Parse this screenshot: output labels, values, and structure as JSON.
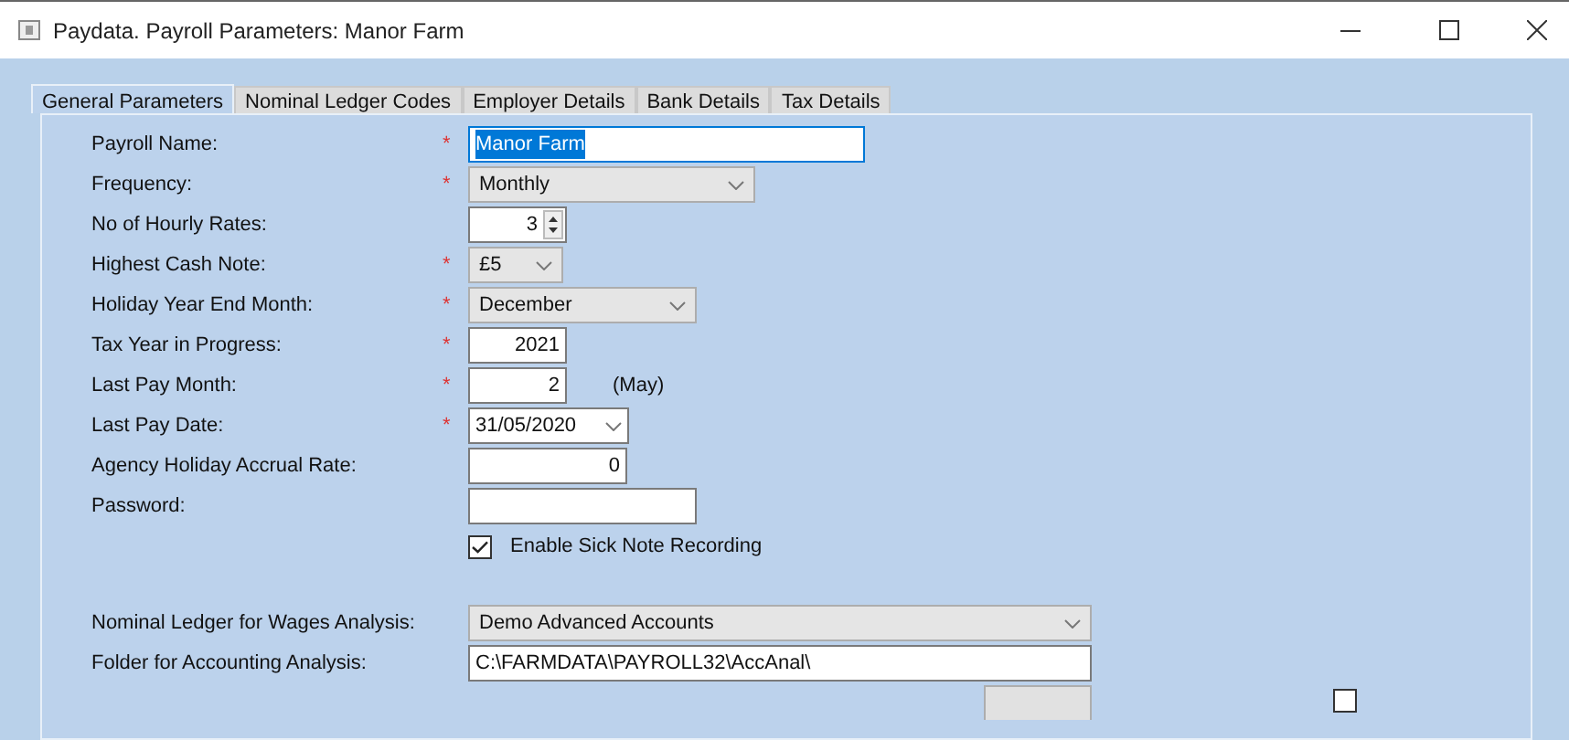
{
  "window": {
    "title": "Paydata. Payroll Parameters: Manor Farm"
  },
  "tabs": [
    {
      "label": "General Parameters",
      "selected": true
    },
    {
      "label": "Nominal Ledger Codes",
      "selected": false
    },
    {
      "label": "Employer Details",
      "selected": false
    },
    {
      "label": "Bank Details",
      "selected": false
    },
    {
      "label": "Tax Details",
      "selected": false
    }
  ],
  "fields": [
    {
      "label": "Payroll Name:",
      "marker": "*",
      "kind": "text",
      "value": "Manor Farm",
      "text_selected": true
    },
    {
      "label": "Frequency:",
      "marker": "*",
      "kind": "combo",
      "value": "Monthly"
    },
    {
      "label": "No of Hourly Rates:",
      "kind": "spin",
      "value": "3"
    },
    {
      "label": "Highest Cash Note:",
      "marker": "*",
      "kind": "combo",
      "value": "£5"
    },
    {
      "label": "Holiday Year End Month:",
      "marker": "*",
      "kind": "combo",
      "value": "December"
    },
    {
      "label": "Tax Year in Progress:",
      "marker": "*",
      "kind": "number",
      "value": "2021"
    },
    {
      "label": "Last Pay Month:",
      "marker": "*",
      "kind": "number",
      "value": "2",
      "note": "(May)"
    },
    {
      "label": "Last Pay Date:",
      "marker": "*",
      "kind": "date",
      "value": "31/05/2020"
    },
    {
      "label": "Agency Holiday Accrual Rate:",
      "kind": "number",
      "value": "0"
    },
    {
      "label": "Password:",
      "kind": "text"
    }
  ],
  "sick_note": {
    "label": "Enable Sick Note Recording",
    "checked": true
  },
  "ledger": [
    {
      "label": "Nominal Ledger for Wages Analysis:",
      "kind": "combo",
      "value": "Demo Advanced Accounts"
    },
    {
      "label": "Folder for Accounting Analysis:",
      "kind": "text",
      "value": "C:\\FARMDATA\\PAYROLL32\\AccAnal\\"
    }
  ],
  "bottom_checkbox": {
    "checked": false
  }
}
